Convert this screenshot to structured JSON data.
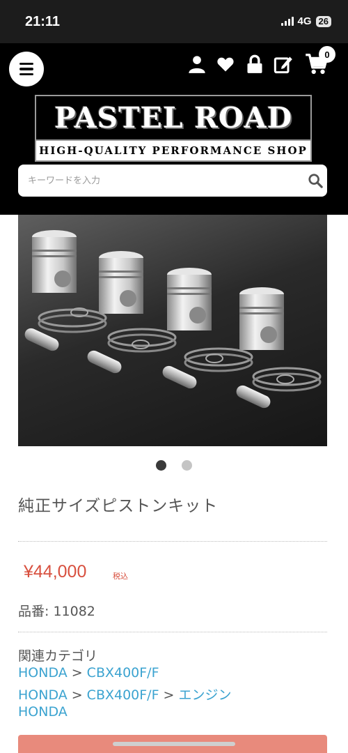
{
  "status_bar": {
    "time": "21:11",
    "network": "4G",
    "battery": "26"
  },
  "header": {
    "icons": [
      "account-icon",
      "heart-icon",
      "lock-icon",
      "edit-icon",
      "cart-icon"
    ],
    "cart_count": "0",
    "logo": {
      "title": "PASTEL ROAD",
      "subtitle": "HIGH-QUALITY PERFORMANCE SHOP"
    },
    "search": {
      "placeholder": "キーワードを入力"
    }
  },
  "gallery": {
    "image_count": 2,
    "active_index": 0
  },
  "product": {
    "title": "純正サイズピストンキット",
    "price": "¥44,000",
    "tax_label": "税込",
    "part_number": "品番: 11082"
  },
  "categories": {
    "label": "関連カテゴリ",
    "separator": ">",
    "paths": [
      [
        "HONDA",
        "CBX400F/F"
      ],
      [
        "HONDA",
        "CBX400F/F",
        "エンジン"
      ],
      [
        "HONDA"
      ]
    ]
  },
  "colors": {
    "accent_price": "#d8503f",
    "link": "#3ba3d0",
    "header_bg": "#000000",
    "cart_button": "#e88a7c"
  }
}
